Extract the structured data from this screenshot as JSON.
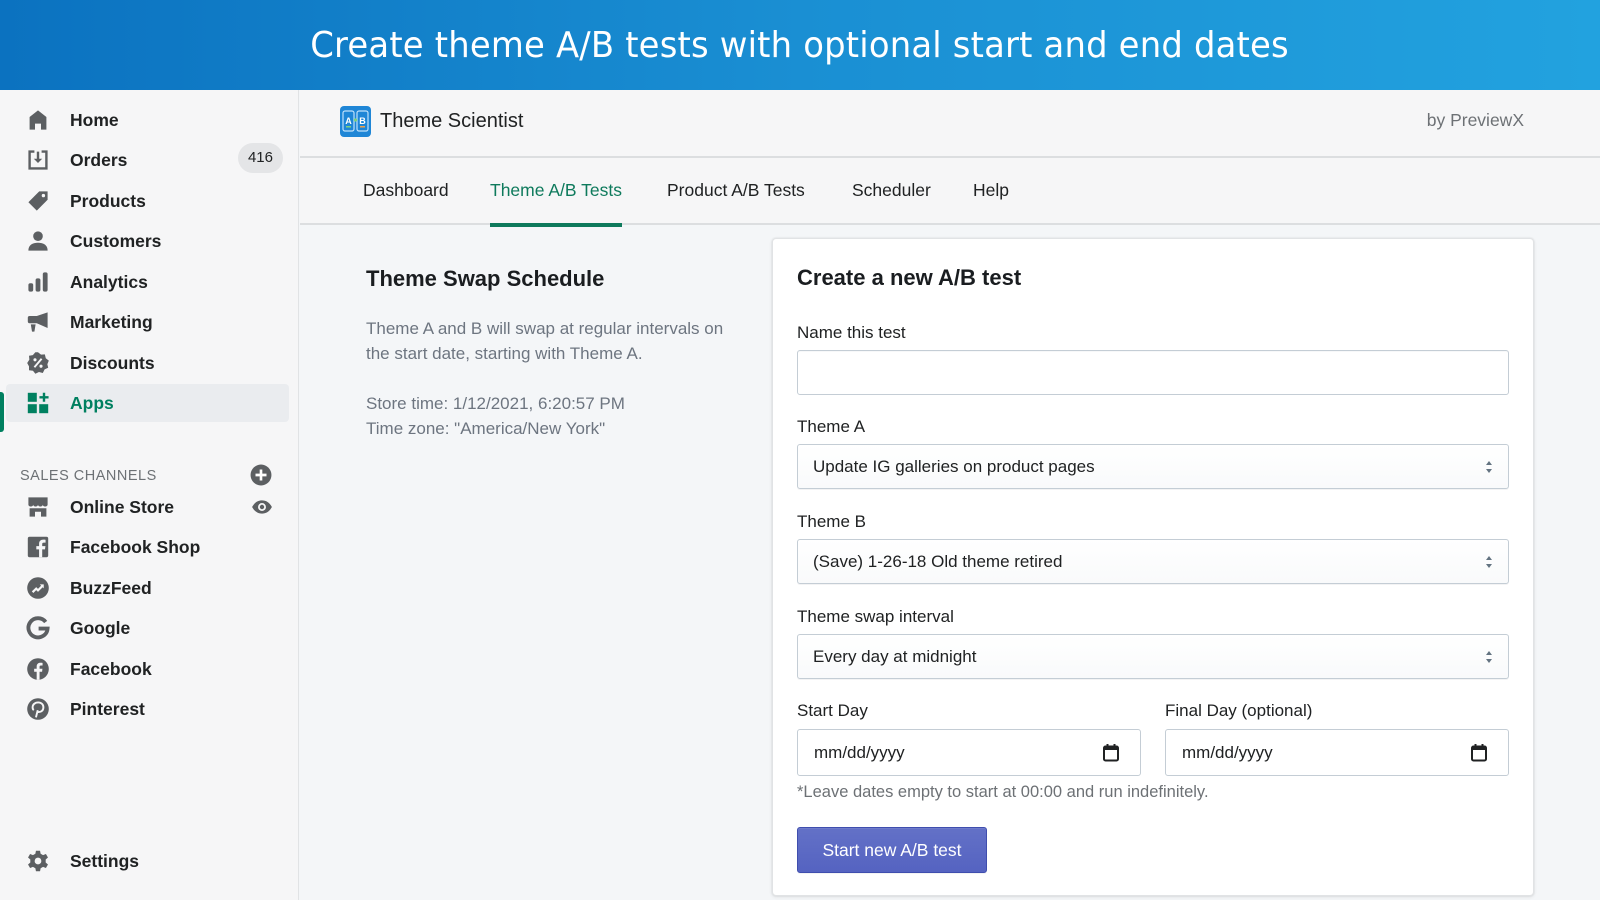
{
  "banner": {
    "title": "Create theme A/B tests with optional start and end dates"
  },
  "sidebar": {
    "items": [
      {
        "label": "Home",
        "icon": "home-icon"
      },
      {
        "label": "Orders",
        "icon": "orders-icon",
        "badge": "416"
      },
      {
        "label": "Products",
        "icon": "tag-icon"
      },
      {
        "label": "Customers",
        "icon": "person-icon"
      },
      {
        "label": "Analytics",
        "icon": "bar-chart-icon"
      },
      {
        "label": "Marketing",
        "icon": "megaphone-icon"
      },
      {
        "label": "Discounts",
        "icon": "discount-icon"
      },
      {
        "label": "Apps",
        "icon": "apps-icon",
        "active": true
      }
    ],
    "sales_channels": {
      "heading": "SALES CHANNELS",
      "items": [
        {
          "label": "Online Store",
          "icon": "store-icon"
        },
        {
          "label": "Facebook Shop",
          "icon": "facebook-square-icon"
        },
        {
          "label": "BuzzFeed",
          "icon": "buzzfeed-icon"
        },
        {
          "label": "Google",
          "icon": "google-icon"
        },
        {
          "label": "Facebook",
          "icon": "facebook-circle-icon"
        },
        {
          "label": "Pinterest",
          "icon": "pinterest-icon"
        }
      ]
    },
    "settings": {
      "label": "Settings",
      "icon": "gear-icon"
    }
  },
  "app": {
    "name": "Theme Scientist",
    "by": "by PreviewX",
    "logo_text": "A/B"
  },
  "tabs": [
    {
      "label": "Dashboard"
    },
    {
      "label": "Theme A/B Tests",
      "active": true
    },
    {
      "label": "Product A/B Tests"
    },
    {
      "label": "Scheduler"
    },
    {
      "label": "Help"
    }
  ],
  "info": {
    "title": "Theme Swap Schedule",
    "description": "Theme A and B will swap at regular intervals on the start date, starting with Theme A.",
    "store_time": "Store time: 1/12/2021, 6:20:57 PM",
    "time_zone": "Time zone: \"America/New York\""
  },
  "form": {
    "title": "Create a new A/B test",
    "name_label": "Name this test",
    "name_value": "",
    "name_placeholder": "",
    "theme_a_label": "Theme A",
    "theme_a_value": "Update IG galleries on product pages",
    "theme_b_label": "Theme B",
    "theme_b_value": "(Save) 1-26-18 Old theme retired",
    "interval_label": "Theme swap interval",
    "interval_value": "Every day at midnight",
    "start_label": "Start Day",
    "start_value": "mm/dd/yyyy",
    "final_label": "Final Day (optional)",
    "final_value": "mm/dd/yyyy",
    "help_text": "*Leave dates empty to start at 00:00 and run indefinitely.",
    "submit_label": "Start new A/B test"
  },
  "colors": {
    "accent_green": "#008060",
    "primary_button": "#5c6ac4",
    "banner_blue": "#1a8fd3"
  }
}
